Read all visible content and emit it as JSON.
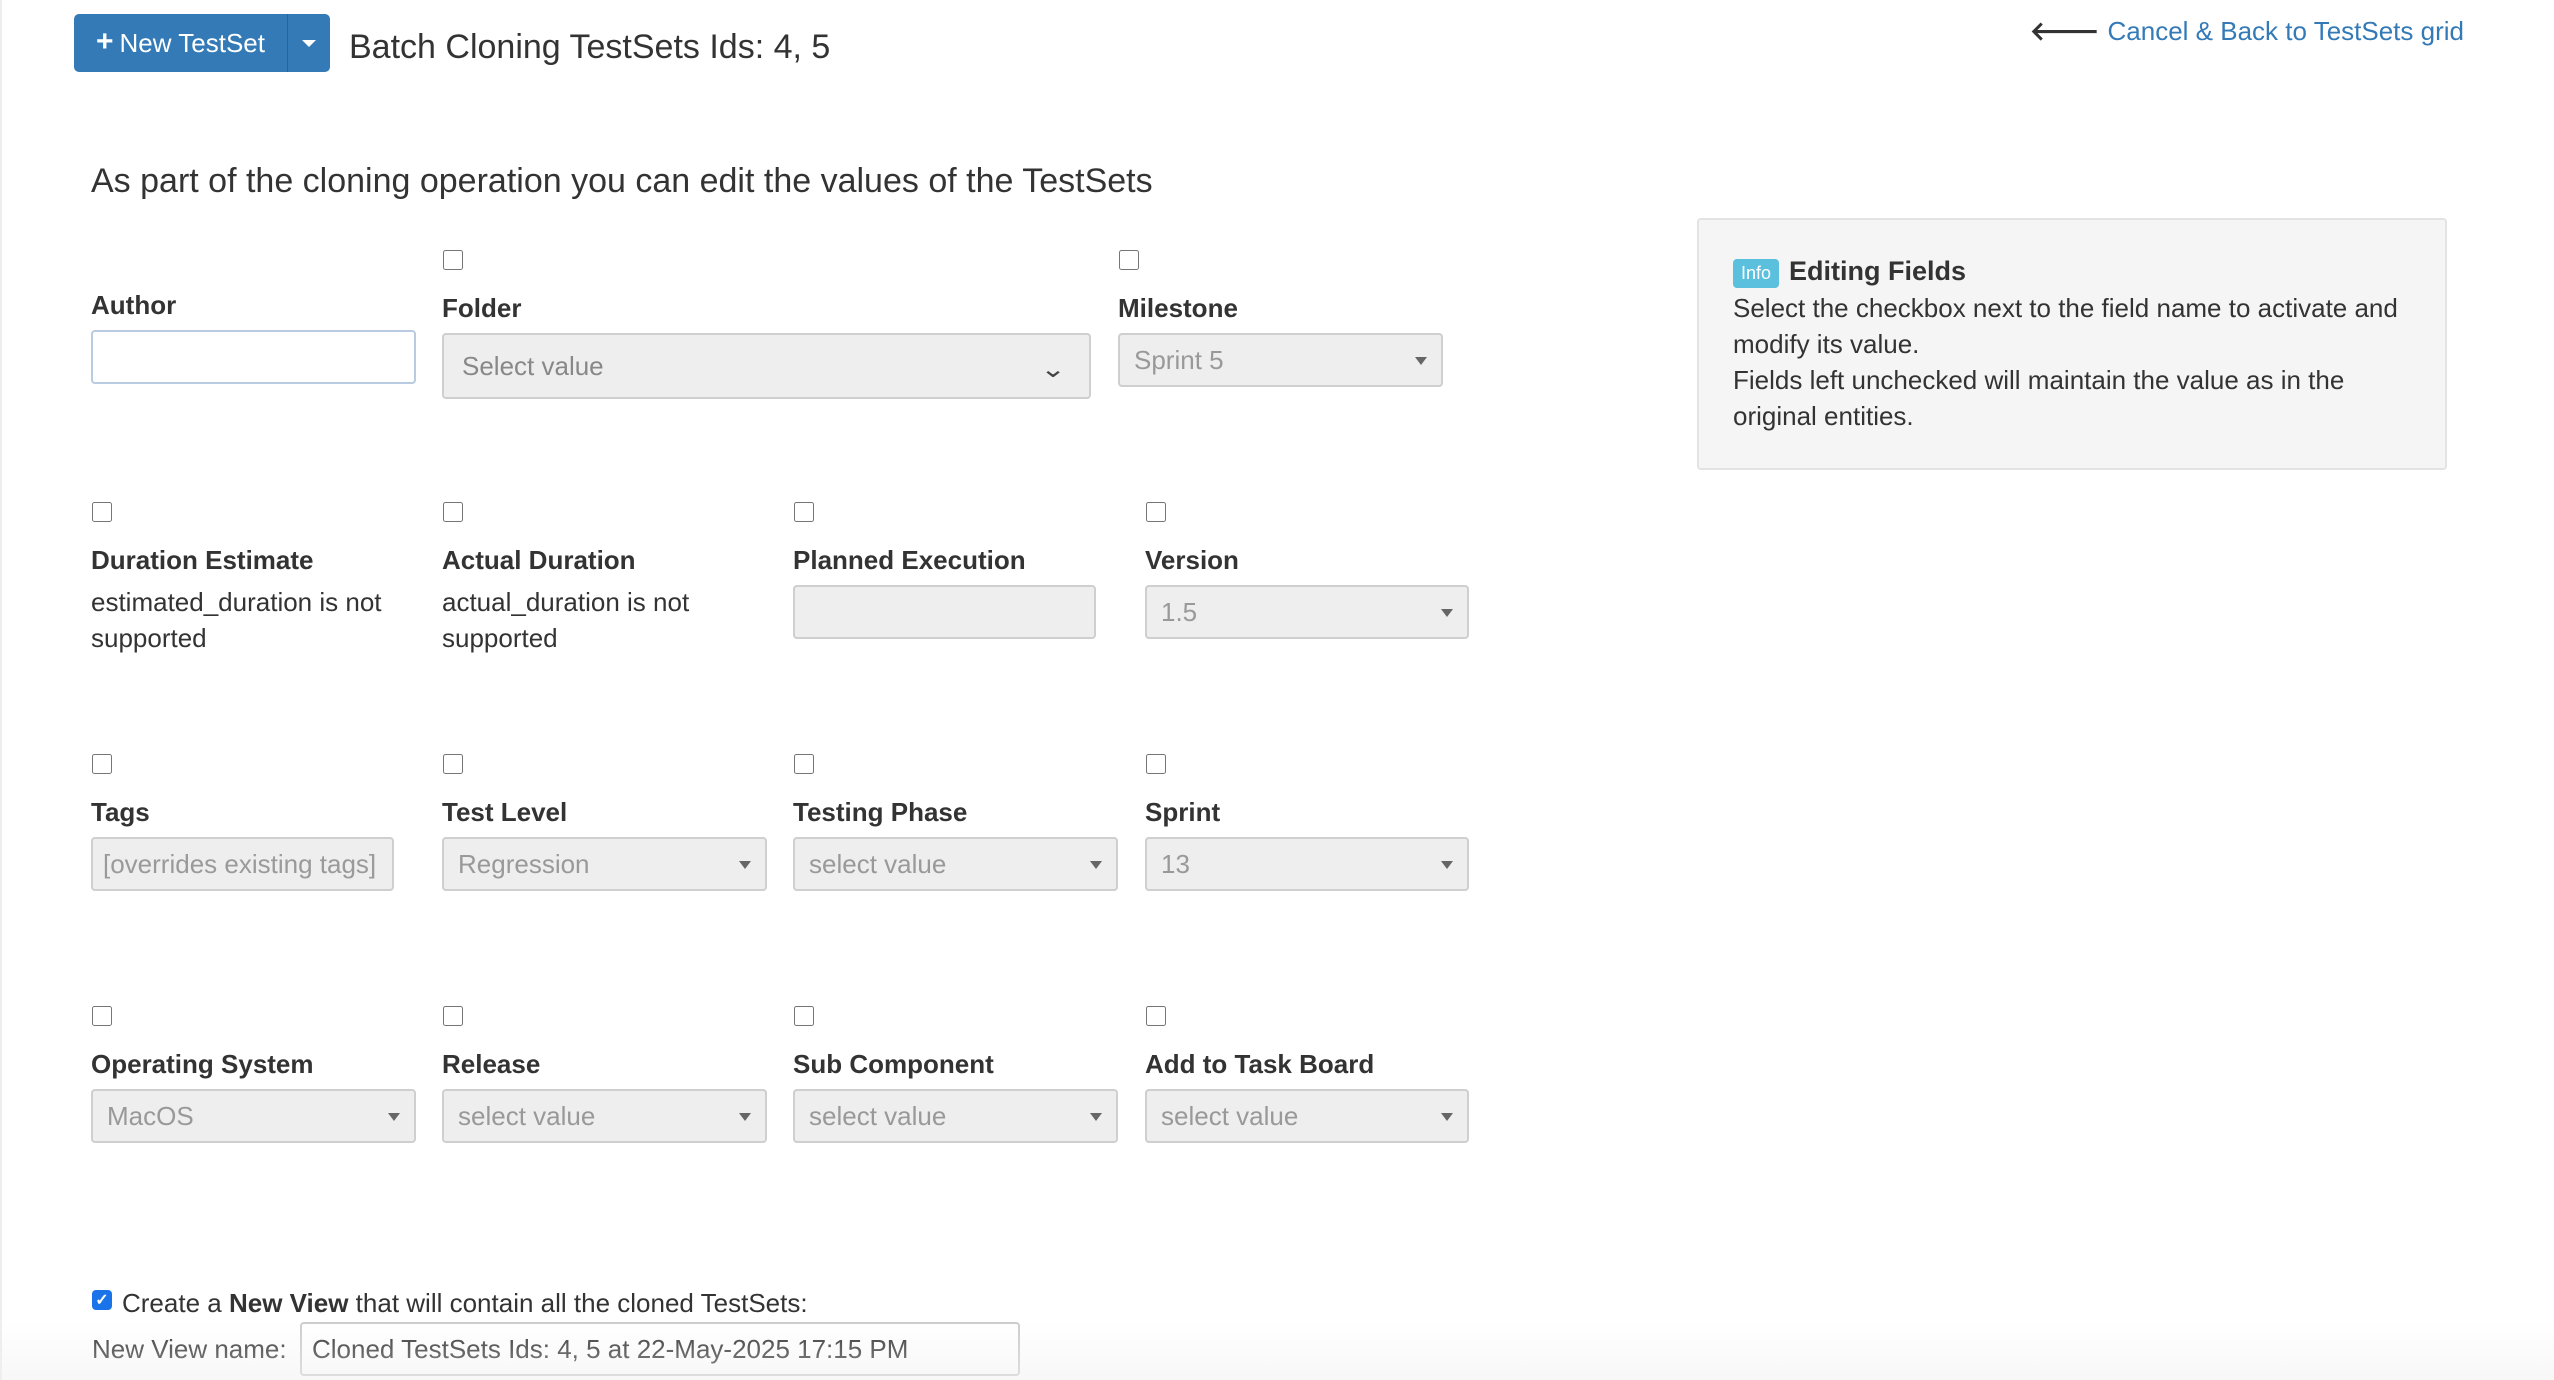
{
  "header": {
    "new_button_label": "New TestSet",
    "page_title": "Batch Cloning TestSets Ids: 4, 5",
    "back_link": "Cancel & Back to TestSets grid",
    "subtitle": "As part of the cloning operation you can edit the values of the TestSets"
  },
  "fields": {
    "author": {
      "label": "Author",
      "value": ""
    },
    "folder": {
      "label": "Folder",
      "placeholder": "Select value"
    },
    "milestone": {
      "label": "Milestone",
      "value": "Sprint 5"
    },
    "duration_estimate": {
      "label": "Duration Estimate",
      "note_line1": "estimated_duration is not",
      "note_line2": "supported"
    },
    "actual_duration": {
      "label": "Actual Duration",
      "note_line1": "actual_duration is not",
      "note_line2": "supported"
    },
    "planned_execution": {
      "label": "Planned Execution",
      "value": ""
    },
    "version": {
      "label": "Version",
      "value": "1.5"
    },
    "tags": {
      "label": "Tags",
      "placeholder": "[overrides existing tags]"
    },
    "test_level": {
      "label": "Test Level",
      "value": "Regression"
    },
    "testing_phase": {
      "label": "Testing Phase",
      "value": "select value"
    },
    "sprint": {
      "label": "Sprint",
      "value": "13"
    },
    "operating_system": {
      "label": "Operating System",
      "value": "MacOS"
    },
    "release": {
      "label": "Release",
      "value": "select value"
    },
    "sub_component": {
      "label": "Sub Component",
      "value": "select value"
    },
    "task_board": {
      "label": "Add to Task Board",
      "value": "select value"
    }
  },
  "info": {
    "badge": "Info",
    "title": "Editing Fields",
    "line1": "Select the checkbox next to the field name to activate and",
    "line2": "modify its value.",
    "line3": "Fields left unchecked will maintain the value as in the",
    "line4": "original entities."
  },
  "new_view": {
    "checked": true,
    "text_pre": "Create a",
    "text_bold": "New View",
    "text_post": "that will contain all the cloned TestSets:",
    "name_label": "New View name:",
    "name_value": "Cloned TestSets Ids: 4, 5 at 22-May-2025 17:15 PM"
  },
  "colors": {
    "primary": "#337ab7",
    "info_badge": "#5bc0de",
    "checkbox_checked": "#1a73e8"
  }
}
